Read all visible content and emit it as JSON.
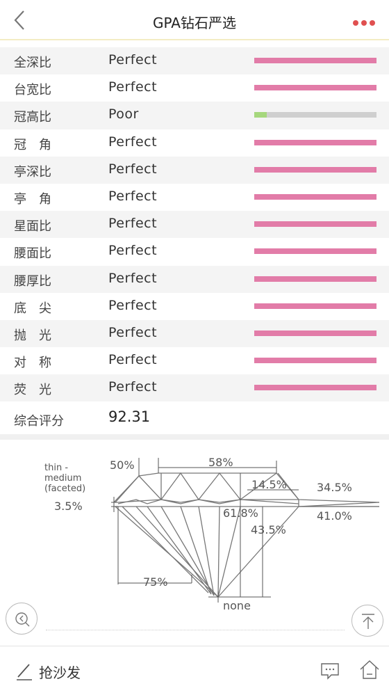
{
  "header": {
    "title": "GPA钻石严选",
    "back_icon": "chevron-left-icon",
    "more_icon": "more-dots-icon"
  },
  "colors": {
    "good": "#e27ca8",
    "poor_fill": "#a6d77d",
    "track": "#cfcfcf",
    "more_dots": "#e05050"
  },
  "grades": [
    {
      "label": "全深比",
      "grade": "Perfect",
      "level": 1.0
    },
    {
      "label": "台宽比",
      "grade": "Perfect",
      "level": 1.0
    },
    {
      "label": "冠高比",
      "grade": "Poor",
      "level": 0.1
    },
    {
      "label": "冠　角",
      "grade": "Perfect",
      "level": 1.0
    },
    {
      "label": "亭深比",
      "grade": "Perfect",
      "level": 1.0
    },
    {
      "label": "亭　角",
      "grade": "Perfect",
      "level": 1.0
    },
    {
      "label": "星面比",
      "grade": "Perfect",
      "level": 1.0
    },
    {
      "label": "腰面比",
      "grade": "Perfect",
      "level": 1.0
    },
    {
      "label": "腰厚比",
      "grade": "Perfect",
      "level": 1.0
    },
    {
      "label": "底　尖",
      "grade": "Perfect",
      "level": 1.0
    },
    {
      "label": "抛　光",
      "grade": "Perfect",
      "level": 1.0
    },
    {
      "label": "对　称",
      "grade": "Perfect",
      "level": 1.0
    },
    {
      "label": "荧　光",
      "grade": "Perfect",
      "level": 1.0
    }
  ],
  "total": {
    "label": "综合评分",
    "score": "92.31"
  },
  "diagram": {
    "girdle_desc_1": "thin -",
    "girdle_desc_2": "medium",
    "girdle_desc_3": "(faceted)",
    "girdle_pct": "3.5%",
    "star_pct": "50%",
    "table_pct": "58%",
    "crown_height_pct": "14.5%",
    "crown_angle": "34.5%",
    "total_depth_pct": "61.8%",
    "pavilion_depth_pct": "43.5%",
    "pavilion_angle": "41.0%",
    "lower_half_pct": "75%",
    "culet": "none"
  },
  "float_buttons": {
    "left_icon": "zoom-out-icon",
    "right_icon": "scroll-to-top-icon"
  },
  "footer": {
    "sofa_label": "抢沙发",
    "pencil_icon": "pencil-icon",
    "comment_icon": "comment-icon",
    "home_icon": "home-icon"
  }
}
